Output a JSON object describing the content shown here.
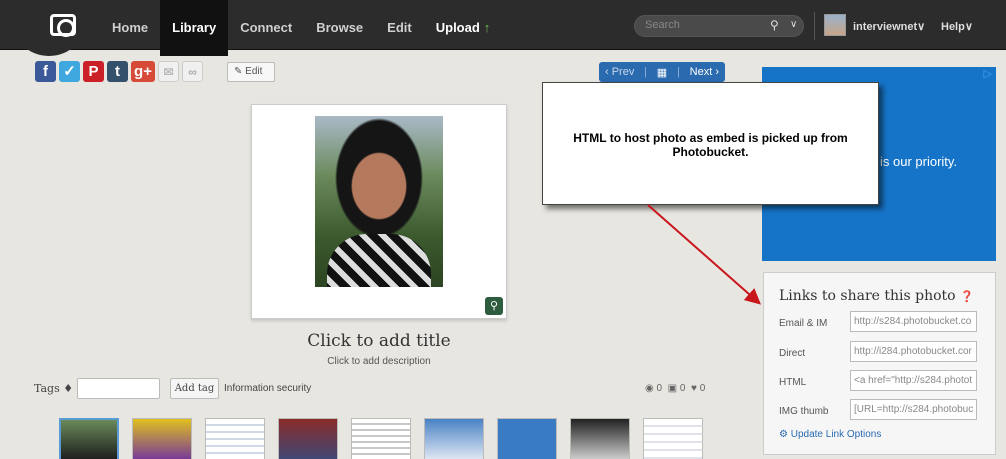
{
  "nav": {
    "items": [
      "Home",
      "Library",
      "Connect",
      "Browse",
      "Edit",
      "Upload"
    ],
    "upload_arrow": "↑"
  },
  "search": {
    "placeholder": "Search"
  },
  "user": {
    "name": "interviewnet∨",
    "help": "Help∨"
  },
  "share": {
    "icons": [
      "facebook-icon",
      "twitter-icon",
      "pinterest-icon",
      "tumblr-icon",
      "googleplus-icon",
      "mail-icon",
      "link-icon"
    ],
    "edit_label": "Edit"
  },
  "pager": {
    "prev": "‹ Prev",
    "next": "Next ›"
  },
  "callout": {
    "text": "HTML to host photo as embed is picked up from Photobucket."
  },
  "ad": {
    "text": "is our priority."
  },
  "photo": {
    "title": "Click to add title",
    "description": "Click to add description"
  },
  "tags": {
    "label": "Tags",
    "add_button": "Add tag",
    "items": [
      "Information security"
    ]
  },
  "stats": {
    "views": "0",
    "comments": "0",
    "likes": "0"
  },
  "links_panel": {
    "title": "Links to share this photo",
    "rows": [
      {
        "label": "Email & IM",
        "value": "http://s284.photobucket.co"
      },
      {
        "label": "Direct",
        "value": "http://i284.photobucket.cor"
      },
      {
        "label": "HTML",
        "value": "<a href=\"http://s284.photot"
      },
      {
        "label": "IMG thumb",
        "value": "[URL=http://s284.photobuc"
      }
    ],
    "update_link": "Update Link Options"
  },
  "colors": {
    "nav_bg": "#2c2c2c",
    "accent_blue": "#2a6bb0",
    "ad_blue": "#1674c8",
    "arrow_red": "#c8161c"
  }
}
